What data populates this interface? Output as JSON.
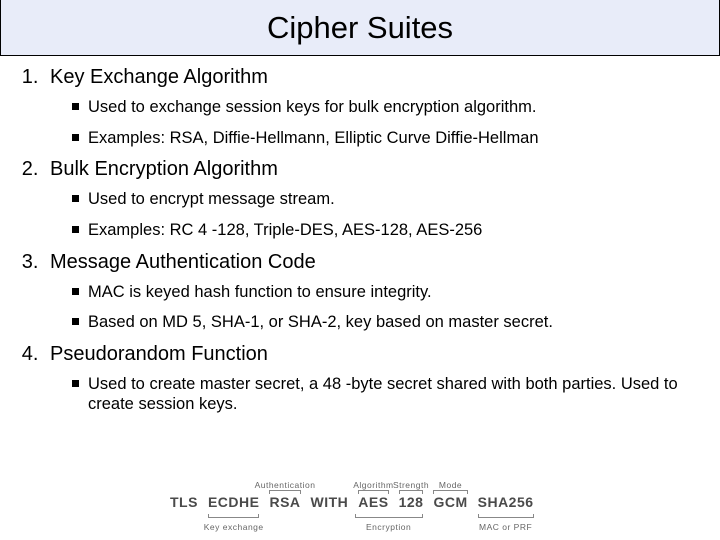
{
  "title": "Cipher Suites",
  "sections": [
    {
      "heading": "Key Exchange Algorithm",
      "bullets": [
        "Used to exchange session keys for bulk encryption algorithm.",
        "Examples: RSA, Diffie-Hellmann, Elliptic Curve Diffie-Hellman"
      ]
    },
    {
      "heading": "Bulk Encryption Algorithm",
      "bullets": [
        "Used to encrypt message stream.",
        "Examples: RC 4 -128, Triple-DES, AES-128, AES-256"
      ]
    },
    {
      "heading": "Message Authentication Code",
      "bullets": [
        "MAC is keyed hash function to ensure integrity.",
        "Based on MD 5, SHA-1, or SHA-2, key based on master secret."
      ]
    },
    {
      "heading": "Pseudorandom Function",
      "bullets": [
        "Used to create master secret, a 48 -byte secret shared with both parties.  Used to create session keys."
      ]
    }
  ],
  "diagram": {
    "tokens": [
      "TLS",
      "ECDHE",
      "RSA",
      "WITH",
      "AES",
      "128",
      "GCM",
      "SHA256"
    ],
    "top_labels": {
      "rsa": "Authentication",
      "aes": "Algorithm",
      "128": "Strength",
      "gcm": "Mode"
    },
    "bottom_labels": {
      "ecdhe": "Key exchange",
      "aes128": "Encryption",
      "sha256": "MAC or PRF"
    }
  }
}
